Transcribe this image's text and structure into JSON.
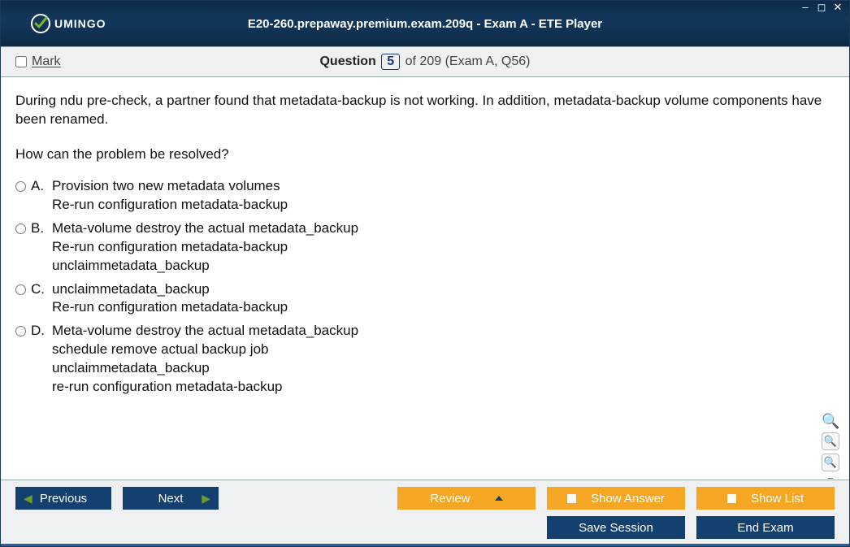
{
  "window": {
    "brand": "UMINGO",
    "title": "E20-260.prepaway.premium.exam.209q - Exam A - ETE Player"
  },
  "info": {
    "mark_label": "Mark",
    "question_word": "Question",
    "current_num": "5",
    "total_suffix": "of 209 (Exam A, Q56)"
  },
  "question": {
    "stem": "During ndu pre-check, a partner found that metadata-backup is not working. In addition, metadata-backup volume components have been renamed.",
    "prompt": "How can the problem be resolved?",
    "options": [
      {
        "letter": "A.",
        "text": "Provision two new metadata volumes\nRe-run configuration metadata-backup"
      },
      {
        "letter": "B.",
        "text": "Meta-volume destroy the actual metadata_backup\nRe-run configuration metadata-backup\nunclaimmetadata_backup"
      },
      {
        "letter": "C.",
        "text": "unclaimmetadata_backup\nRe-run configuration metadata-backup"
      },
      {
        "letter": "D.",
        "text": "Meta-volume destroy the actual metadata_backup\nschedule remove actual backup job\nunclaimmetadata_backup\nre-run configuration metadata-backup"
      }
    ]
  },
  "footer": {
    "previous": "Previous",
    "next": "Next",
    "review": "Review",
    "show_answer": "Show Answer",
    "show_list": "Show List",
    "save_session": "Save Session",
    "end_exam": "End Exam"
  }
}
